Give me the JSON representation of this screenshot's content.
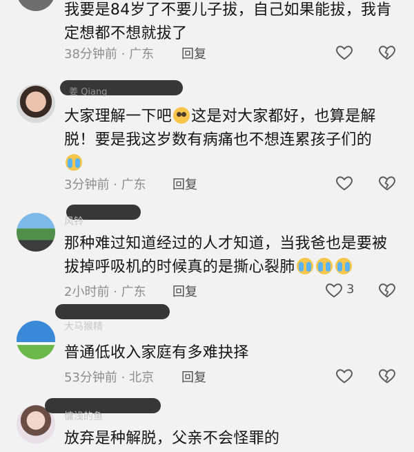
{
  "comments": [
    {
      "name": "",
      "text": "我要是84岁了不要儿子拔，自己如果能拔，我肯定想都不想就拔了",
      "time": "38分钟前 · 广东",
      "reply": "回复"
    },
    {
      "name": "姜 Qiang",
      "text_a": "大家理解一下吧",
      "text_b": "这是对大家都好，也算是解脱！要是我这岁数有病痛也不想连累孩子们的",
      "time": "3分钟前 · 广东",
      "reply": "回复"
    },
    {
      "name": "风铃",
      "text": "那种难过知道经过的人才知道，当我爸也是要被拔掉呼吸机的时候真的是撕心裂肺",
      "time": "2小时前 · 广东",
      "reply": "回复",
      "likes": "3"
    },
    {
      "name": "大马猴精",
      "text": "普通低收入家庭有多难抉择",
      "time": "53分钟前 · 北京",
      "reply": "回复"
    },
    {
      "name": "慵浅的鱼",
      "text": "放弃是种解脱，父亲不会怪罪的"
    }
  ],
  "icons": {
    "like": "heart-outline-icon",
    "dislike": "broken-heart-icon",
    "emoji_cry": "loudly-crying-face-emoji",
    "emoji_plead": "pleading-face-emoji"
  },
  "colors": {
    "background": "#f2f2f2",
    "text": "#141414",
    "meta": "#8d8d8d",
    "cry_tears": "#5ab3f2",
    "emoji_face": "#f6c54a"
  }
}
